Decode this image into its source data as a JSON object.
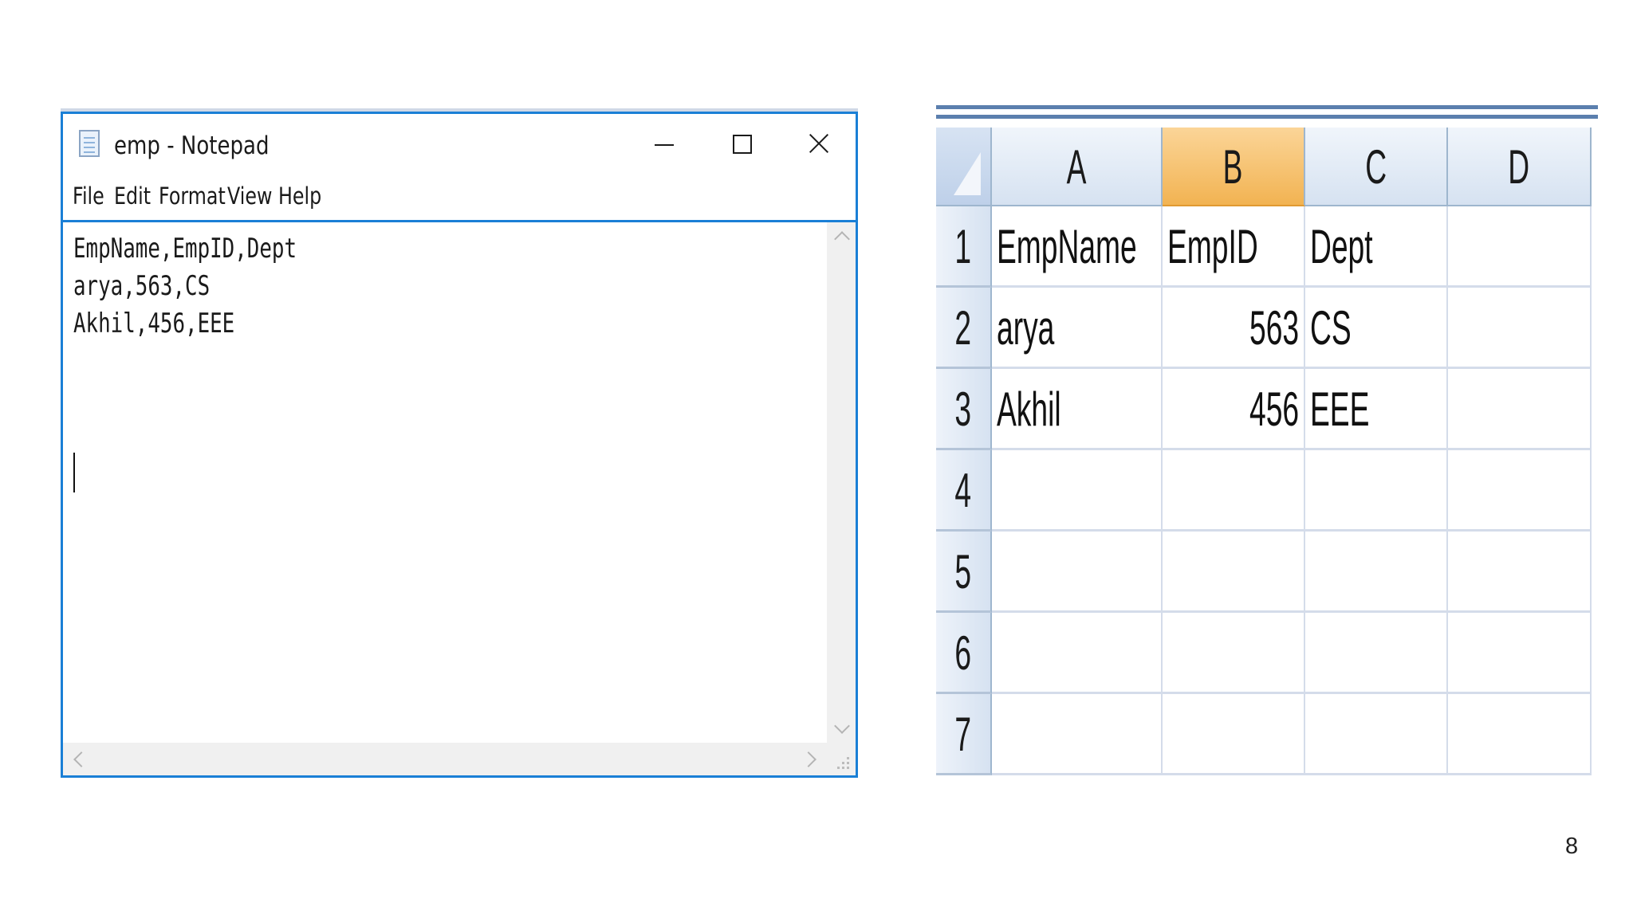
{
  "notepad": {
    "title": "emp - Notepad",
    "menu": [
      "File",
      "Edit",
      "Format",
      "View",
      "Help"
    ],
    "content": [
      "EmpName,EmpID,Dept",
      "arya,563,CS",
      "Akhil,456,EEE"
    ]
  },
  "spreadsheet": {
    "columns": [
      "A",
      "B",
      "C",
      "D"
    ],
    "selected_column": "B",
    "row_numbers": [
      "1",
      "2",
      "3",
      "4",
      "5",
      "6",
      "7"
    ],
    "rows": [
      [
        "EmpName",
        "EmpID",
        "Dept",
        ""
      ],
      [
        "arya",
        "563",
        "CS",
        ""
      ],
      [
        "Akhil",
        "456",
        "EEE",
        ""
      ],
      [
        "",
        "",
        "",
        ""
      ],
      [
        "",
        "",
        "",
        ""
      ],
      [
        "",
        "",
        "",
        ""
      ],
      [
        "",
        "",
        "",
        ""
      ]
    ]
  },
  "page_number": "8",
  "colors": {
    "window_border": "#1a7fd6",
    "selected_column_header": "#f2b352",
    "header_background": "#d6e2f1"
  }
}
